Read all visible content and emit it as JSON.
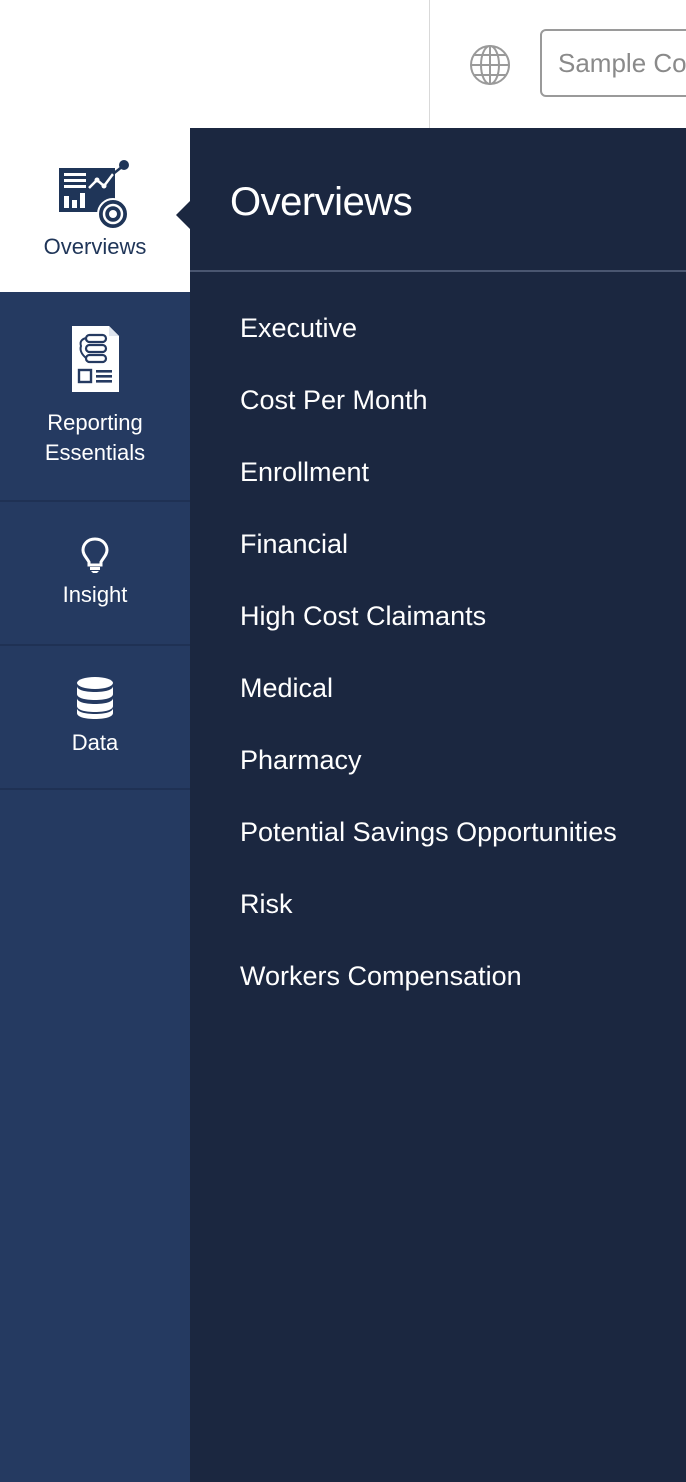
{
  "header": {
    "company_select": {
      "value": "Sample Co"
    },
    "globe_icon": "globe-icon"
  },
  "rail": {
    "items": [
      {
        "label_lines": [
          "Overviews"
        ],
        "icon": "overviews-dashboard-icon",
        "active": true
      },
      {
        "label_lines": [
          "Reporting",
          "Essentials"
        ],
        "icon": "report-document-icon",
        "active": false
      },
      {
        "label_lines": [
          "Insight"
        ],
        "icon": "lightbulb-icon",
        "active": false
      },
      {
        "label_lines": [
          "Data"
        ],
        "icon": "database-icon",
        "active": false
      }
    ]
  },
  "panel": {
    "title": "Overviews",
    "items": [
      "Executive",
      "Cost Per Month",
      "Enrollment",
      "Financial",
      "High Cost Claimants",
      "Medical",
      "Pharmacy",
      "Potential Savings Opportunities",
      "Risk",
      "Workers Compensation"
    ]
  },
  "colors": {
    "rail_bg": "#253a61",
    "panel_bg": "#1b2740",
    "active_bg": "#ffffff",
    "active_text": "#1f3558"
  }
}
